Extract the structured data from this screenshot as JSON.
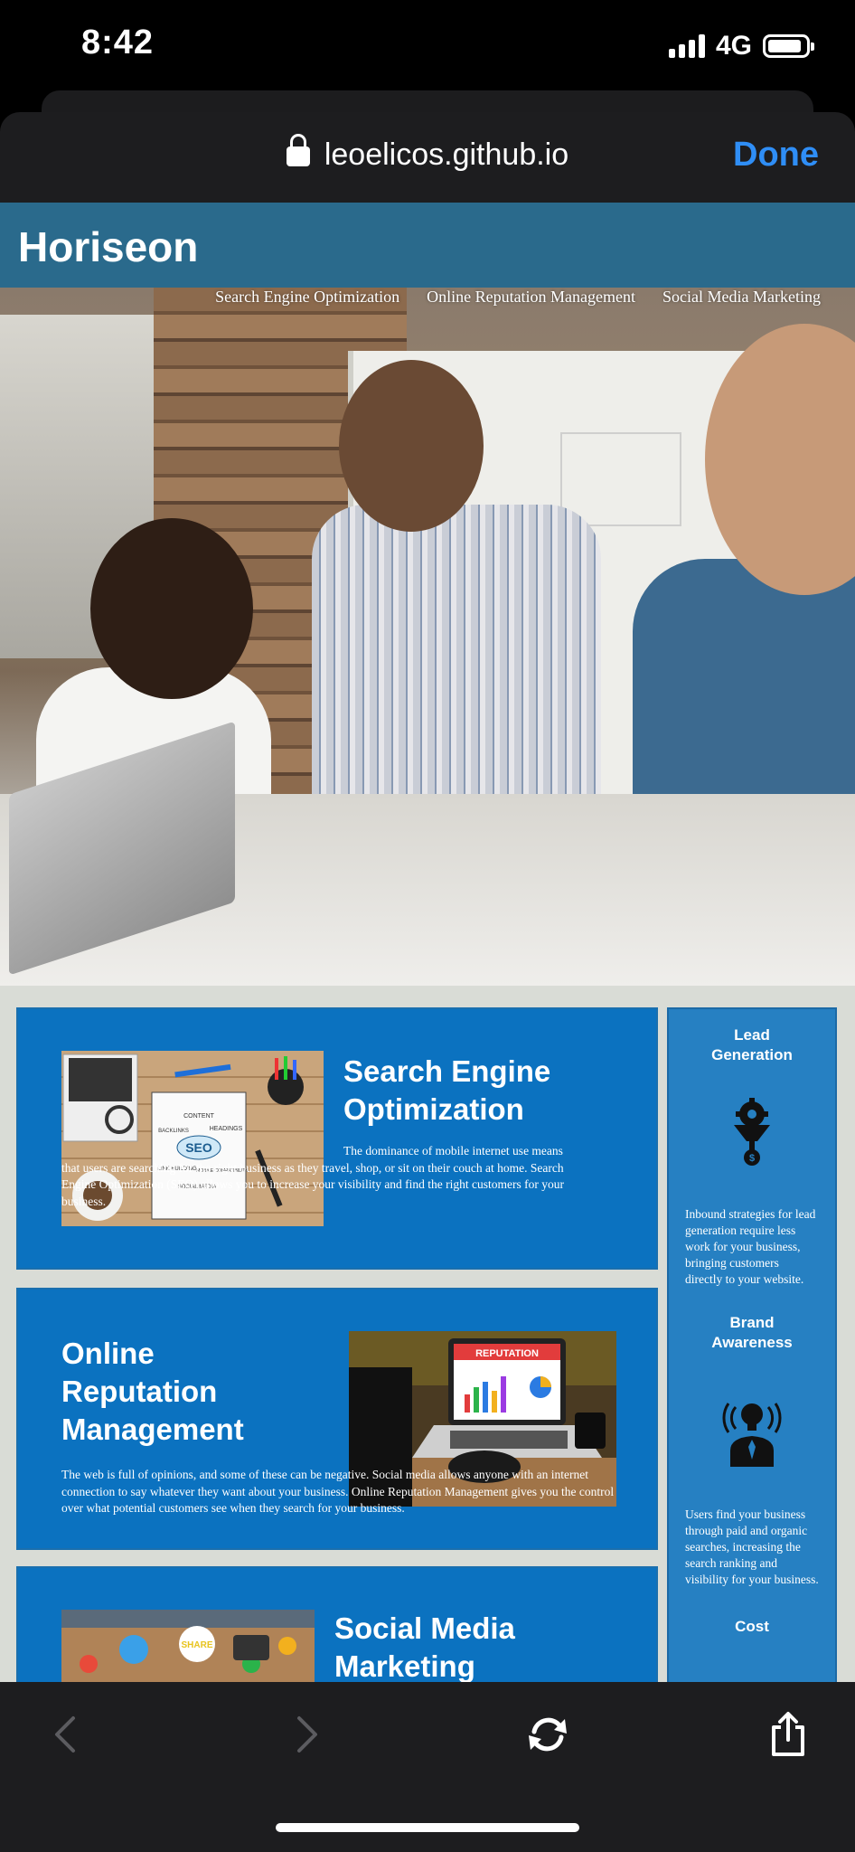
{
  "status_bar": {
    "time": "8:42",
    "network": "4G"
  },
  "browser": {
    "url": "leoelicos.github.io",
    "done_label": "Done"
  },
  "site": {
    "brand": "Horiseon",
    "nav": [
      {
        "label": "Search Engine Optimization"
      },
      {
        "label": "Online Reputation Management"
      },
      {
        "label": "Social Media Marketing"
      }
    ],
    "seo": {
      "title": "Search Engine Optimization",
      "body": "The dominance of mobile internet use means that users are searching for the right business as they travel, shop, or sit on their couch at home. Search Engine Optimization (SEO) allows you to increase your visibility and find the right customers for your business.",
      "image_words": [
        "CONTENT",
        "HEADINGS",
        "BACKLINKS",
        "SEO",
        "LINK BUILDING",
        "MOBILE COMPATIBILITY",
        "SOCIAL MEDIA"
      ]
    },
    "orm": {
      "title": "Online Reputation Management",
      "body": "The web is full of opinions, and some of these can be negative. Social media allows anyone with an internet connection to say whatever they want about your business. Online Reputation Management gives you the control over what potential customers see when they search for your business.",
      "image_word": "REPUTATION"
    },
    "smm": {
      "title": "Social Media Marketing",
      "image_word": "SHARE"
    },
    "benefits": {
      "lead": {
        "title": "Lead Generation",
        "body": "Inbound strategies for lead generation require less work for your business, bringing customers directly to your website."
      },
      "brand": {
        "title": "Brand Awareness",
        "body": "Users find your business through paid and organic searches, increasing the search ranking and visibility for your business."
      },
      "cost": {
        "title": "Cost"
      }
    }
  },
  "colors": {
    "header": "#2a6a8c",
    "card": "#0b72c0",
    "aside": "#2680c2",
    "done": "#2f8ef6"
  },
  "icons": [
    "lock-icon",
    "back-icon",
    "forward-icon",
    "reload-icon",
    "share-icon",
    "gear-funnel-icon",
    "lightbulb-person-icon"
  ]
}
